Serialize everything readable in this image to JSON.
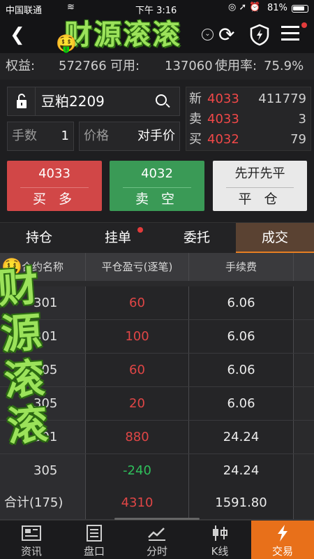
{
  "status_bar": {
    "carrier": "中国联通",
    "time": "下午 3:16",
    "battery": "81%"
  },
  "nav": {
    "title": "财源滚滚"
  },
  "account": {
    "equity_label": "权益:",
    "equity_value": "572766",
    "available_label": "可用:",
    "available_value": "137060",
    "usage_label": "使用率:",
    "usage_value": "75.9%"
  },
  "order": {
    "contract": "豆粕2209",
    "qty_label": "手数",
    "qty_value": "1",
    "price_label": "价格",
    "price_value": "对手价"
  },
  "quote": [
    {
      "key": "新",
      "price": "4033",
      "value": "411779"
    },
    {
      "key": "卖",
      "price": "4033",
      "value": "3"
    },
    {
      "key": "买",
      "price": "4032",
      "value": "79"
    }
  ],
  "buttons": {
    "buy": {
      "price": "4033",
      "label": "买 多"
    },
    "sell": {
      "price": "4032",
      "label": "卖 空"
    },
    "close": {
      "price": "先开先平",
      "label": "平 仓"
    }
  },
  "tabs": [
    "持仓",
    "挂单",
    "委托",
    "成交"
  ],
  "table": {
    "headers": [
      "合约名称",
      "平仓盈亏(逐笔)",
      "手续费"
    ],
    "rows": [
      {
        "name": "301",
        "pnl": "60",
        "fee": "6.06"
      },
      {
        "name": "301",
        "pnl": "100",
        "fee": "6.06"
      },
      {
        "name": "305",
        "pnl": "60",
        "fee": "6.06"
      },
      {
        "name": "305",
        "pnl": "20",
        "fee": "6.06"
      },
      {
        "name": "301",
        "pnl": "880",
        "fee": "24.24"
      },
      {
        "name": "305",
        "pnl": "-240",
        "fee": "24.24"
      }
    ],
    "total": {
      "name": "合计(175)",
      "pnl": "4310",
      "fee": "1591.80"
    }
  },
  "overlay_text": "财源滚滚",
  "bottom_nav": [
    "资讯",
    "盘口",
    "分时",
    "K线",
    "交易"
  ],
  "colors": {
    "up": "#e04646",
    "down": "#2fbf5b",
    "accent": "#e8701a"
  }
}
